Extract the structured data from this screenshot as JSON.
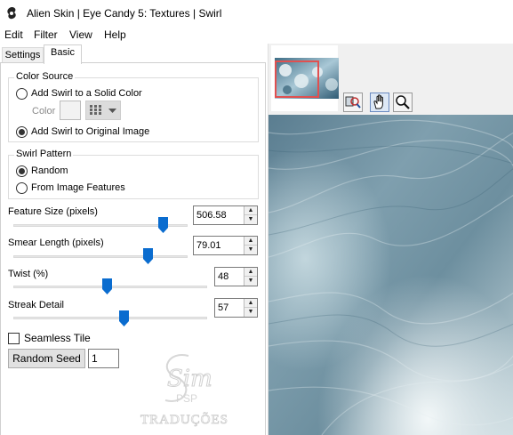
{
  "window": {
    "title": "Alien Skin | Eye Candy 5: Textures | Swirl"
  },
  "menu": [
    "Edit",
    "Filter",
    "View",
    "Help"
  ],
  "tabs": [
    {
      "label": "Settings",
      "active": false
    },
    {
      "label": "Basic",
      "active": true
    }
  ],
  "color_source": {
    "title": "Color Source",
    "option_solid": "Add Swirl to a Solid Color",
    "color_label": "Color",
    "option_original": "Add Swirl to Original Image",
    "selected": "original"
  },
  "swirl_pattern": {
    "title": "Swirl Pattern",
    "option_random": "Random",
    "option_features": "From Image Features",
    "selected": "random"
  },
  "controls": {
    "feature_size": {
      "label": "Feature Size (pixels)",
      "value": "506.58"
    },
    "smear_length": {
      "label": "Smear Length (pixels)",
      "value": "79.01"
    },
    "twist": {
      "label": "Twist (%)",
      "value": "48"
    },
    "streak_detail": {
      "label": "Streak Detail",
      "value": "57"
    }
  },
  "seamless_tile": {
    "label": "Seamless Tile",
    "checked": false
  },
  "random_seed": {
    "button_label": "Random Seed",
    "value": "1"
  },
  "watermark": {
    "line1": "Sim",
    "line2": "PSP",
    "line3": "TRADUÇÕES"
  },
  "colors": {
    "accent": "#0a6ccf",
    "preview_dark": "#5d7f92",
    "preview_light": "#dce7ea",
    "nav_frame": "#e05050"
  },
  "icons": [
    "swirl-app-icon",
    "radio-icon",
    "grid-swatch-icon",
    "chevron-down-icon",
    "slider-thumb-icon",
    "spin-up-icon",
    "spin-down-icon",
    "zoom-compare-icon",
    "hand-icon",
    "magnifier-icon"
  ]
}
